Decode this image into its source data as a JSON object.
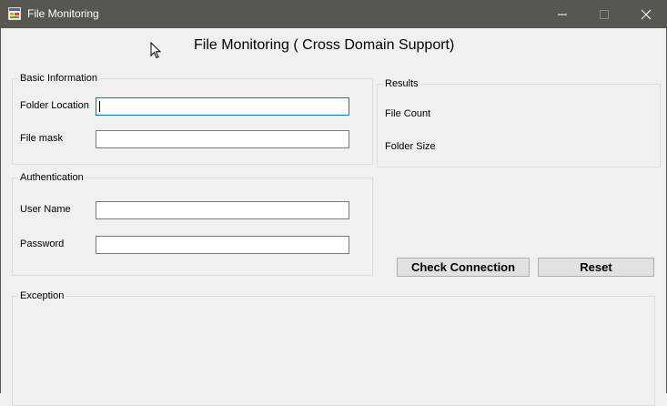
{
  "window": {
    "title": "File Monitoring",
    "minimize_icon": "minimize-icon",
    "maximize_icon": "maximize-icon",
    "close_icon": "close-icon",
    "app_icon": "app-icon"
  },
  "heading": "File Monitoring ( Cross Domain Support)",
  "basic_info": {
    "legend": "Basic Information",
    "folder_location_label": "Folder Location",
    "folder_location_value": "",
    "file_mask_label": "File mask",
    "file_mask_value": ""
  },
  "authentication": {
    "legend": "Authentication",
    "user_name_label": "User Name",
    "user_name_value": "",
    "password_label": "Password",
    "password_value": ""
  },
  "results": {
    "legend": "Results",
    "file_count_label": "File Count",
    "folder_size_label": "Folder Size"
  },
  "buttons": {
    "check_connection": "Check Connection",
    "reset": "Reset"
  },
  "exception": {
    "legend": "Exception"
  },
  "colors": {
    "titlebar": "#595551",
    "focus_border": "#0078d7",
    "background": "#f0f0f0"
  }
}
